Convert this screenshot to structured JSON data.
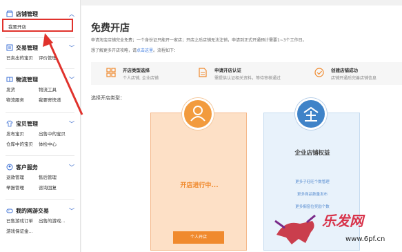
{
  "sidebar": {
    "sections": [
      {
        "title": "店铺管理",
        "icon": "store-icon",
        "items": [
          "我要开店"
        ]
      },
      {
        "title": "交易管理",
        "icon": "trade-icon",
        "items": [
          "已卖出的宝贝",
          "评价管理"
        ]
      },
      {
        "title": "物流管理",
        "icon": "logistics-icon",
        "items": [
          "发货",
          "物流工具",
          "物流服务",
          "我要寄快递"
        ]
      },
      {
        "title": "宝贝管理",
        "icon": "goods-icon",
        "items": [
          "发布宝贝",
          "出售中的宝贝",
          "仓库中的宝贝",
          "体检中心"
        ]
      },
      {
        "title": "客户服务",
        "icon": "customer-icon",
        "items": [
          "退款管理",
          "售后管理",
          "举报管理",
          "咨询回复"
        ]
      },
      {
        "title": "我的网游交易",
        "icon": "game-icon",
        "items": [
          "已售游戏订单",
          "出售的游戏...",
          "游戏保证金..."
        ]
      }
    ]
  },
  "main": {
    "title": "免费开店",
    "desc1": "申请淘宝店铺完全免费；一个身份证只能开一家店；开店之后店铺无法注销，申请到正式开通预计需要1~3个工作日。",
    "desc2_pre": "想了解更多开店攻略，请",
    "desc2_link": "点击这里",
    "desc2_post": "。流程如下：",
    "steps": [
      {
        "title": "开店类型选择",
        "desc": "个人店铺, 企业店铺",
        "icon": "grid-icon"
      },
      {
        "title": "申请开店认证",
        "desc": "需提供认证相关资料，等待审核通过",
        "icon": "document-icon"
      },
      {
        "title": "创建店铺成功",
        "desc": "店铺开通后完善店铺信息",
        "icon": "check-circle-icon"
      }
    ],
    "choose_label": "选择开店类型：",
    "card_personal": {
      "status": "开店进行中...",
      "button": "个人开店"
    },
    "card_enterprise": {
      "title": "企业店铺权益",
      "benefits": [
        "更多子旺旺个数管理",
        "更多商品数量发布",
        "更多橱窗位奖励个数"
      ]
    }
  },
  "watermark": {
    "brand": "乐发网",
    "url": "www.6pf.cn"
  },
  "colors": {
    "accent_orange": "#f08a2e",
    "accent_blue": "#3f83c8",
    "highlight_red": "#e0322c"
  }
}
